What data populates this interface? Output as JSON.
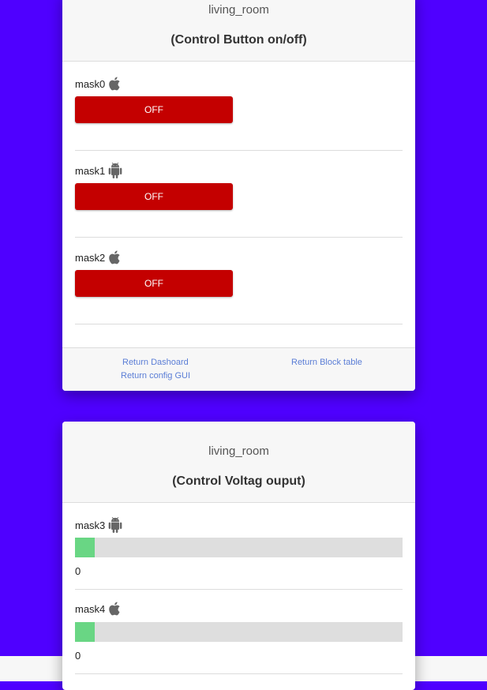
{
  "colors": {
    "background": "#4f00ff",
    "off_button": "#c40000",
    "progress_fill": "#69d684",
    "link": "#5b7ed6"
  },
  "switch_panel": {
    "room": "living_room",
    "subtitle": "(Control Button on/off)",
    "items": [
      {
        "label": "mask0",
        "icon": "apple-icon",
        "state": "OFF"
      },
      {
        "label": "mask1",
        "icon": "android-icon",
        "state": "OFF"
      },
      {
        "label": "mask2",
        "icon": "apple-icon",
        "state": "OFF"
      }
    ],
    "links": {
      "dashboard": "Return Dashoard",
      "block_table": "Return Block table",
      "config_gui": "Return config GUI"
    }
  },
  "voltage_panel": {
    "room": "living_room",
    "subtitle": "(Control Voltag ouput)",
    "items": [
      {
        "label": "mask3",
        "icon": "android-icon",
        "value": "0",
        "level_fraction": 0.06
      },
      {
        "label": "mask4",
        "icon": "apple-icon",
        "value": "0",
        "level_fraction": 0.06
      }
    ]
  }
}
